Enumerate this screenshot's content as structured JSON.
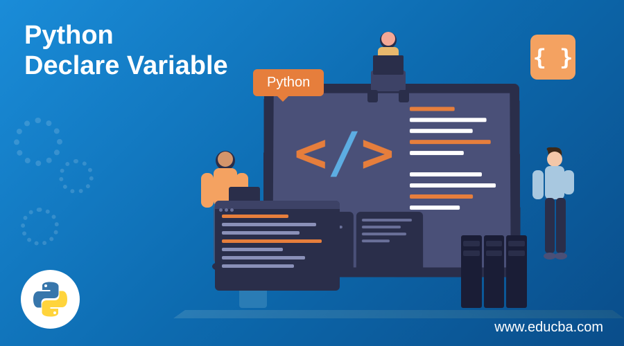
{
  "title_line1": "Python",
  "title_line2": "Declare Variable",
  "footer_url": "www.educba.com",
  "python_tag": "Python",
  "curly_braces": "{ }",
  "code_bracket_open": "<",
  "code_bracket_slash": "/",
  "code_bracket_close": ">",
  "icons": {
    "python_logo": "python-logo-icon",
    "gear": "gear-icon",
    "curly_badge": "curly-braces-icon"
  }
}
